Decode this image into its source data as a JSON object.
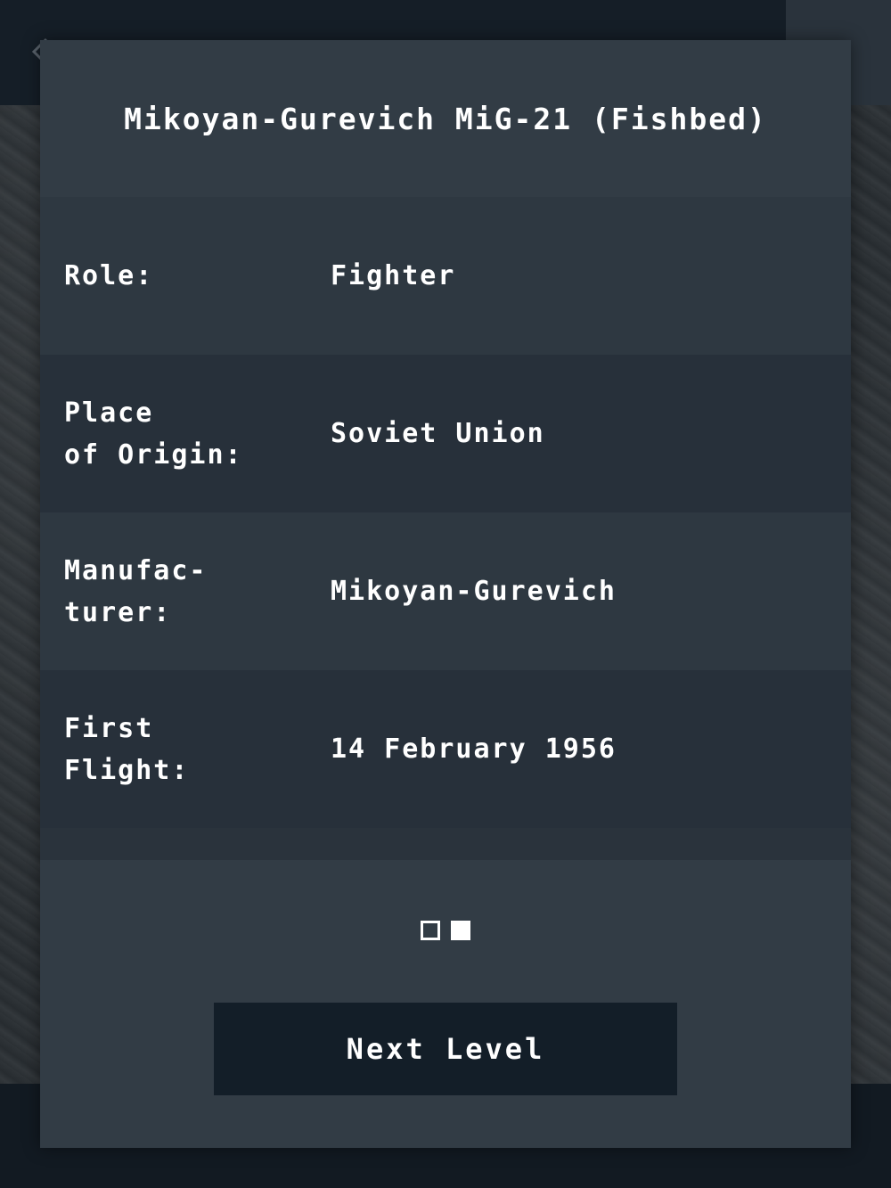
{
  "aircraft": {
    "title": "Mikoyan-Gurevich MiG-21 (Fishbed)"
  },
  "details": [
    {
      "label": "Role:",
      "value": "Fighter"
    },
    {
      "label": "Place\nof Origin:",
      "value": "Soviet Union"
    },
    {
      "label": "Manufac-\nturer:",
      "value": "Mikoyan-Gurevich"
    },
    {
      "label": "First\nFlight:",
      "value": "14 February 1956"
    }
  ],
  "pager": {
    "total_pages": 2,
    "current_page": 2
  },
  "actions": {
    "next_level_label": "Next Level"
  },
  "icons": {
    "back": "chevron-left-icon"
  },
  "colors": {
    "modal_background": "#323c45",
    "row_dark": "#27303a",
    "row_light": "#2e3841",
    "button_background": "#131e28",
    "text": "#ffffff"
  }
}
